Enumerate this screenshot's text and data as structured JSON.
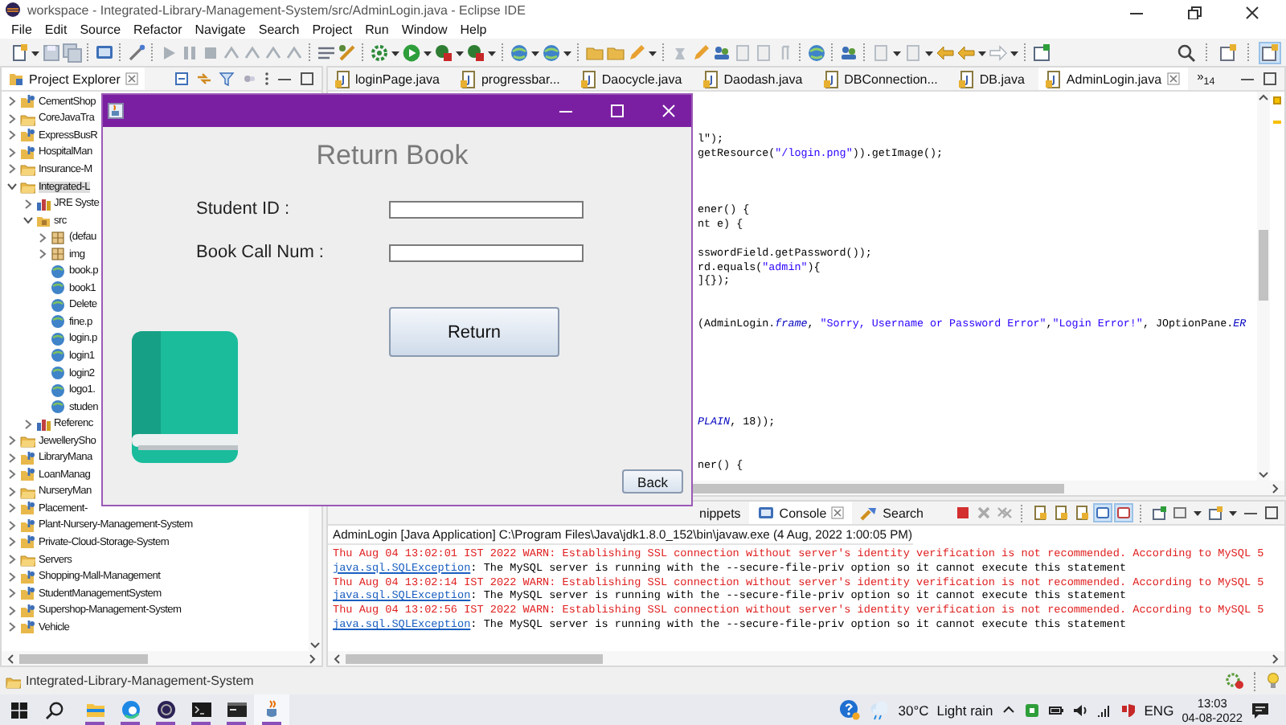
{
  "window": {
    "title": "workspace - Integrated-Library-Management-System/src/AdminLogin.java - Eclipse IDE"
  },
  "menu": [
    "File",
    "Edit",
    "Source",
    "Refactor",
    "Navigate",
    "Search",
    "Project",
    "Run",
    "Window",
    "Help"
  ],
  "explorer": {
    "title": "Project Explorer",
    "items": [
      {
        "label": "CementShop",
        "kind": "java-project",
        "expanded": false,
        "selected": false
      },
      {
        "label": "CoreJavaTra",
        "kind": "project",
        "expanded": false,
        "selected": false
      },
      {
        "label": "ExpressBusR",
        "kind": "java-project",
        "expanded": false,
        "selected": false
      },
      {
        "label": "HospitalMan",
        "kind": "java-project",
        "expanded": false,
        "selected": false
      },
      {
        "label": "Insurance-M",
        "kind": "project",
        "expanded": false,
        "selected": false
      },
      {
        "label": "Integrated-L",
        "kind": "project",
        "expanded": true,
        "selected": true,
        "children": [
          {
            "label": "JRE Syste",
            "kind": "library",
            "expanded": false
          },
          {
            "label": "src",
            "kind": "source-folder",
            "expanded": true,
            "children": [
              {
                "label": "(defau",
                "kind": "package",
                "expanded": false
              },
              {
                "label": "img",
                "kind": "package",
                "expanded": false
              },
              {
                "label": "book.p",
                "kind": "image-file"
              },
              {
                "label": "book1",
                "kind": "image-file"
              },
              {
                "label": "Delete",
                "kind": "image-file"
              },
              {
                "label": "fine.p",
                "kind": "image-file"
              },
              {
                "label": "login.p",
                "kind": "image-file"
              },
              {
                "label": "login1",
                "kind": "image-file"
              },
              {
                "label": "login2",
                "kind": "image-file"
              },
              {
                "label": "logo1.",
                "kind": "image-file"
              },
              {
                "label": "studen",
                "kind": "image-file"
              }
            ]
          },
          {
            "label": "Referenc",
            "kind": "library",
            "expanded": false
          }
        ]
      },
      {
        "label": "JewellerySho",
        "kind": "project",
        "expanded": false,
        "selected": false
      },
      {
        "label": "LibraryMana",
        "kind": "java-project",
        "expanded": false,
        "selected": false
      },
      {
        "label": "LoanManag",
        "kind": "java-project",
        "expanded": false,
        "selected": false
      },
      {
        "label": "NurseryMan",
        "kind": "project",
        "expanded": false,
        "selected": false
      },
      {
        "label": "Placement-",
        "kind": "java-project",
        "expanded": false,
        "selected": false
      },
      {
        "label": "Plant-Nursery-Management-System",
        "kind": "java-project",
        "expanded": false,
        "selected": false
      },
      {
        "label": "Private-Cloud-Storage-System",
        "kind": "java-project",
        "expanded": false,
        "selected": false
      },
      {
        "label": "Servers",
        "kind": "project",
        "expanded": false,
        "selected": false
      },
      {
        "label": "Shopping-Mall-Management",
        "kind": "java-project",
        "expanded": false,
        "selected": false
      },
      {
        "label": "StudentManagementSystem",
        "kind": "java-project",
        "expanded": false,
        "selected": false
      },
      {
        "label": "Supershop-Management-System",
        "kind": "java-project",
        "expanded": false,
        "selected": false
      },
      {
        "label": "Vehicle",
        "kind": "java-project",
        "expanded": false,
        "selected": false
      }
    ]
  },
  "editor": {
    "tabs": [
      {
        "label": "loginPage.java",
        "selected": false
      },
      {
        "label": "progressbar...",
        "selected": false
      },
      {
        "label": "Daocycle.java",
        "selected": false
      },
      {
        "label": "Daodash.java",
        "selected": false
      },
      {
        "label": "DBConnection...",
        "selected": false
      },
      {
        "label": "DB.java",
        "selected": false
      },
      {
        "label": "AdminLogin.java",
        "selected": true
      }
    ],
    "overflow": "»$_{14}$",
    "lines": [
      {
        "kind": "blank"
      },
      {
        "kind": "blank"
      },
      {
        "kind": "blank"
      },
      {
        "kind": "code",
        "tokens": [
          {
            "kind": "plain",
            "text": "l\");"
          }
        ]
      },
      {
        "kind": "code",
        "tokens": [
          {
            "kind": "plain",
            "text": "getResource("
          },
          {
            "kind": "string",
            "text": "\"/login.png\""
          },
          {
            "kind": "plain",
            "text": ")).getImage();"
          }
        ]
      },
      {
        "kind": "blank"
      },
      {
        "kind": "blank"
      },
      {
        "kind": "blank"
      },
      {
        "kind": "code",
        "tokens": [
          {
            "kind": "plain",
            "text": "ener() {"
          }
        ]
      },
      {
        "kind": "code",
        "tokens": [
          {
            "kind": "plain",
            "text": "nt e) {"
          }
        ]
      },
      {
        "kind": "blank"
      },
      {
        "kind": "code",
        "tokens": [
          {
            "kind": "plain",
            "text": "sswordField.getPassword());"
          }
        ]
      },
      {
        "kind": "code",
        "tokens": [
          {
            "kind": "plain",
            "text": "rd.equals("
          },
          {
            "kind": "string",
            "text": "\"admin\""
          },
          {
            "kind": "plain",
            "text": "){"
          }
        ]
      },
      {
        "kind": "code",
        "tokens": [
          {
            "kind": "plain",
            "text": "]{});"
          }
        ]
      },
      {
        "kind": "blank"
      },
      {
        "kind": "blank"
      },
      {
        "kind": "code",
        "tokens": [
          {
            "kind": "plain",
            "text": "(AdminLogin."
          },
          {
            "kind": "static",
            "text": "frame"
          },
          {
            "kind": "plain",
            "text": ", "
          },
          {
            "kind": "string",
            "text": "\"Sorry, Username or Password Error\""
          },
          {
            "kind": "plain",
            "text": ","
          },
          {
            "kind": "string",
            "text": "\"Login Error!\""
          },
          {
            "kind": "plain",
            "text": ", JOptionPane."
          },
          {
            "kind": "static",
            "text": "ER"
          }
        ]
      },
      {
        "kind": "blank"
      },
      {
        "kind": "blank"
      },
      {
        "kind": "blank"
      },
      {
        "kind": "blank"
      },
      {
        "kind": "blank"
      },
      {
        "kind": "blank"
      },
      {
        "kind": "code",
        "tokens": [
          {
            "kind": "static",
            "text": "PLAIN"
          },
          {
            "kind": "plain",
            "text": ", 18));"
          }
        ]
      },
      {
        "kind": "blank"
      },
      {
        "kind": "blank"
      },
      {
        "kind": "code",
        "tokens": [
          {
            "kind": "plain",
            "text": "ner() {"
          }
        ]
      }
    ]
  },
  "console": {
    "tabs": [
      {
        "label": "nippets",
        "kind": "snippets",
        "selected": false
      },
      {
        "label": "Console",
        "kind": "console",
        "selected": true
      },
      {
        "label": "Search",
        "kind": "search",
        "selected": false
      }
    ],
    "header": "AdminLogin [Java Application] C:\\Program Files\\Java\\jdk1.8.0_152\\bin\\javaw.exe  (4 Aug, 2022 1:00:05 PM)",
    "lines": [
      {
        "kind": "warn",
        "text": "Thu Aug 04 13:02:01 IST 2022 WARN: Establishing SSL connection without server's identity verification is not recommended. According to MySQL 5"
      },
      {
        "kind": "exception",
        "link": "java.sql.SQLException",
        "text": ": The MySQL server is running with the --secure-file-priv option so it cannot execute this statement"
      },
      {
        "kind": "warn",
        "text": "Thu Aug 04 13:02:14 IST 2022 WARN: Establishing SSL connection without server's identity verification is not recommended. According to MySQL 5"
      },
      {
        "kind": "exception",
        "link": "java.sql.SQLException",
        "text": ": The MySQL server is running with the --secure-file-priv option so it cannot execute this statement"
      },
      {
        "kind": "warn",
        "text": "Thu Aug 04 13:02:56 IST 2022 WARN: Establishing SSL connection without server's identity verification is not recommended. According to MySQL 5"
      },
      {
        "kind": "exception",
        "link": "java.sql.SQLException",
        "text": ": The MySQL server is running with the --secure-file-priv option so it cannot execute this statement"
      }
    ]
  },
  "status_bar": {
    "text": "Integrated-Library-Management-System"
  },
  "taskbar": {
    "apps": [
      {
        "kind": "files",
        "running": true,
        "selected": false
      },
      {
        "kind": "browser",
        "running": true,
        "selected": false
      },
      {
        "kind": "eclipse",
        "running": true,
        "selected": false
      },
      {
        "kind": "terminal",
        "running": true,
        "selected": false
      },
      {
        "kind": "console",
        "running": true,
        "selected": false
      },
      {
        "kind": "java",
        "running": true,
        "selected": true
      }
    ],
    "temperature": "30°C",
    "weather": "Light rain",
    "language": "ENG",
    "time": "13:03",
    "date": "04-08-2022"
  },
  "dialog": {
    "heading": "Return Book",
    "fields": [
      {
        "label": "Student ID :"
      },
      {
        "label": "Book Call Num :"
      }
    ],
    "submit": "Return",
    "back": "Back"
  }
}
